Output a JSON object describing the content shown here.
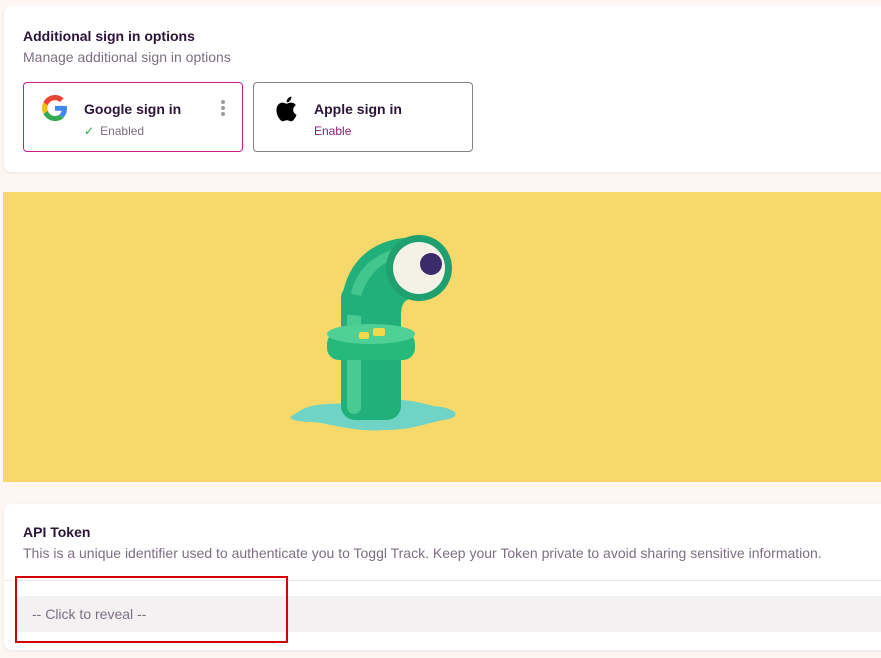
{
  "signin": {
    "title": "Additional sign in options",
    "subtitle": "Manage additional sign in options",
    "google": {
      "name": "Google sign in",
      "status": "Enabled",
      "icon": "google-icon"
    },
    "apple": {
      "name": "Apple sign in",
      "action": "Enable",
      "icon": "apple-icon"
    }
  },
  "api": {
    "title": "API Token",
    "description": "This is a unique identifier used to authenticate you to Toggl Track. Keep your Token private to avoid sharing sensitive information.",
    "token_placeholder": "-- Click to reveal --"
  },
  "colors": {
    "accent": "#c81d8f",
    "link": "#8e1d79",
    "banner": "#f7d96b",
    "success": "#2ab040",
    "highlight": "#d40000"
  }
}
